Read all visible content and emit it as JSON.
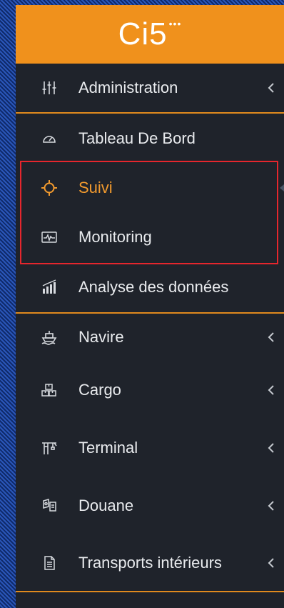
{
  "brand": {
    "logo_text": "Ci5",
    "logo_dots": "•••"
  },
  "menu": {
    "items": [
      {
        "label": "Administration",
        "icon": "sliders-icon",
        "has_submenu": true
      },
      {
        "label": "Tableau De Bord",
        "icon": "gauge-icon",
        "has_submenu": false
      },
      {
        "label": "Suivi",
        "icon": "crosshair-icon",
        "has_submenu": false,
        "active": true
      },
      {
        "label": "Monitoring",
        "icon": "pulse-monitor-icon",
        "has_submenu": false
      },
      {
        "label": "Analyse des données",
        "icon": "bar-chart-icon",
        "has_submenu": false
      },
      {
        "label": "Navire",
        "icon": "ship-icon",
        "has_submenu": true
      },
      {
        "label": "Cargo",
        "icon": "boxes-icon",
        "has_submenu": true
      },
      {
        "label": "Terminal",
        "icon": "crane-icon",
        "has_submenu": true
      },
      {
        "label": "Douane",
        "icon": "customs-icon",
        "has_submenu": true
      },
      {
        "label": "Transports intérieurs",
        "icon": "document-icon",
        "has_submenu": true
      }
    ]
  },
  "colors": {
    "accent": "#f0911c",
    "active_text": "#f29a2e",
    "highlight_border": "#e5262d",
    "sidebar_bg": "#1f232b"
  }
}
